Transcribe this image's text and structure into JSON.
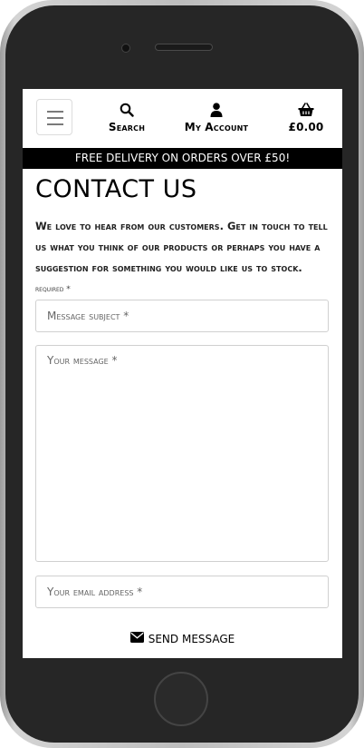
{
  "header": {
    "menu_icon": "hamburger-menu-icon",
    "search_label": "Search",
    "account_label": "My Account",
    "bag_total": "£0.00"
  },
  "banner": {
    "text": "FREE DELIVERY ON ORDERS OVER £50!"
  },
  "page": {
    "title": "CONTACT US",
    "intro": "We love to hear from our customers. Get in touch to tell us what you think of our products or perhaps you have a suggestion for something you would like us to stock.",
    "required_note": "required *"
  },
  "form": {
    "subject_placeholder": "Message subject *",
    "message_placeholder": "Your message *",
    "email_placeholder": "Your email address *",
    "send_label": "SEND MESSAGE"
  }
}
